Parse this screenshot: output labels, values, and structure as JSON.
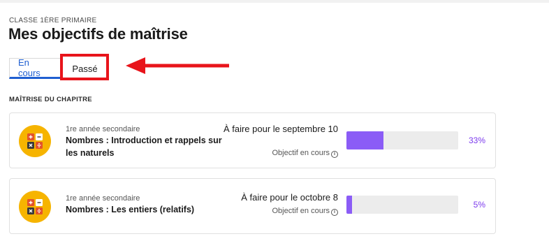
{
  "header": {
    "overline": "CLASSE 1ÈRE PRIMAIRE",
    "title": "Mes objectifs de maîtrise"
  },
  "tabs": [
    {
      "label": "En cours",
      "active": true
    },
    {
      "label": "Passé",
      "active": false
    }
  ],
  "section": {
    "label": "MAÎTRISE DU CHAPITRE"
  },
  "colors": {
    "accent_blue": "#1f5fd1",
    "progress_purple": "#8b5cf6",
    "badge_yellow": "#f6b400",
    "highlight_red": "#e8141b"
  },
  "cards": [
    {
      "grade": "1re année secondaire",
      "chapter": "Nombres : Introduction et rappels sur les naturels",
      "due": "À faire pour le septembre 10",
      "status": "Objectif en cours",
      "progress_percent": 33,
      "progress_label": "33%",
      "icon": "calculator-icon"
    },
    {
      "grade": "1re année secondaire",
      "chapter": "Nombres : Les entiers (relatifs)",
      "due": "À faire pour le octobre 8",
      "status": "Objectif en cours",
      "progress_percent": 5,
      "progress_label": "5%",
      "icon": "calculator-icon"
    }
  ]
}
